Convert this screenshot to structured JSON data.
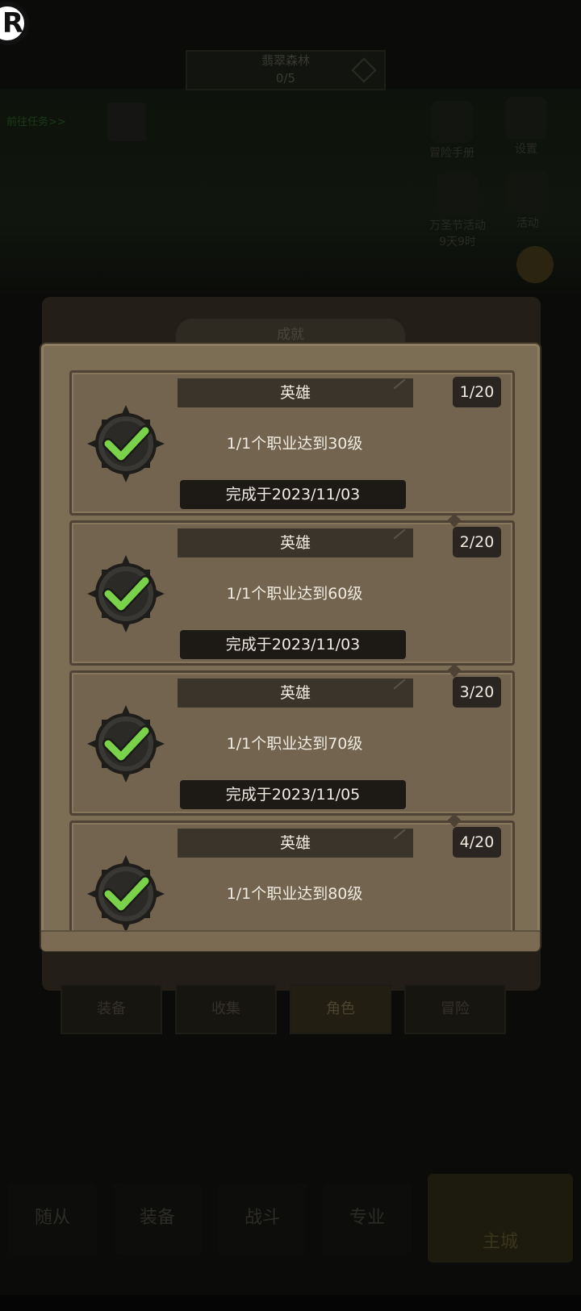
{
  "background": {
    "map_title": "翡翠森林",
    "map_progress": "0/5",
    "quest_hint": "前往任务>>",
    "side_buttons": [
      {
        "label": "冒险手册"
      },
      {
        "label": "设置"
      },
      {
        "label": "万圣节活动"
      },
      {
        "label": "活动"
      }
    ],
    "event_timer": "9天9时",
    "back_panel_title": "成就",
    "tabs": [
      "装备",
      "收集",
      "角色",
      "冒险"
    ],
    "active_tab": "角色",
    "nav": [
      "随从",
      "装备",
      "战斗",
      "专业"
    ],
    "nav_main": "主城"
  },
  "achievements": [
    {
      "category": "英雄",
      "count": "1/20",
      "description": "1/1个职业达到30级",
      "completed": "完成于2023/11/03"
    },
    {
      "category": "英雄",
      "count": "2/20",
      "description": "1/1个职业达到60级",
      "completed": "完成于2023/11/03"
    },
    {
      "category": "英雄",
      "count": "3/20",
      "description": "1/1个职业达到70级",
      "completed": "完成于2023/11/05"
    },
    {
      "category": "英雄",
      "count": "4/20",
      "description": "1/1个职业达到80级",
      "completed": ""
    }
  ],
  "colors": {
    "panel": "#7c6d55",
    "card": "#72644e",
    "check_green": "#7ad24a",
    "badge_dark": "#2c2a27"
  },
  "icons": {
    "badge": "completed-check-badge-icon",
    "record": "record-icon"
  }
}
